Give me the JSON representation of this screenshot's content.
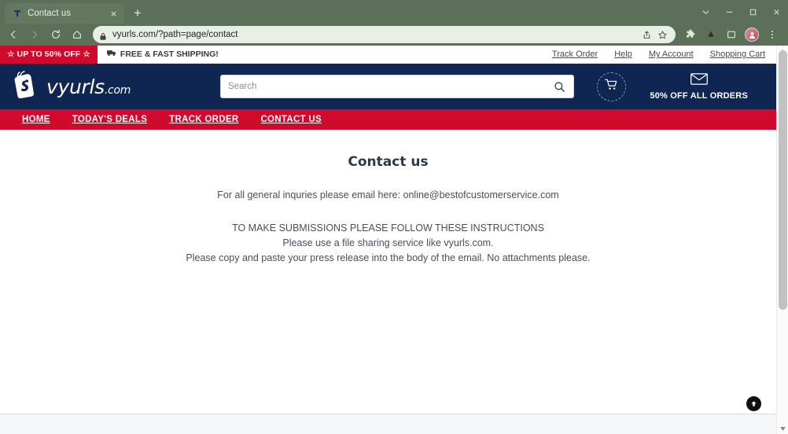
{
  "browser": {
    "tab": {
      "title": "Contact us",
      "favicon": "shopify-t-icon",
      "close_label": "×"
    },
    "new_tab_label": "+",
    "window_controls": [
      {
        "name": "tab-search",
        "glyph": "⌄"
      },
      {
        "name": "minimize",
        "glyph": "–"
      },
      {
        "name": "maximize",
        "glyph": "□"
      },
      {
        "name": "close",
        "glyph": "×"
      }
    ],
    "nav": {
      "back": "←",
      "forward": "→",
      "reload": "↻",
      "home": "⌂"
    },
    "omnibox": {
      "url": "vyurls.com/?path=page/contact",
      "lock": "lock-icon",
      "share": "share-icon",
      "bookmark": "star-icon"
    },
    "toolbar_icons": [
      {
        "name": "extensions-icon"
      },
      {
        "name": "downloads-icon"
      },
      {
        "name": "sidepanel-icon"
      },
      {
        "name": "profile-avatar"
      },
      {
        "name": "chrome-menu-icon"
      }
    ]
  },
  "utility_bar": {
    "promo_badge": "☆ UP TO 50% OFF ☆",
    "shipping_note": "FREE & FAST SHIPPING!",
    "links": [
      "Track Order",
      "Help",
      "My Account",
      "Shopping Cart"
    ]
  },
  "header": {
    "logo_name": "vyurls",
    "logo_suffix": ".com",
    "search_placeholder": "Search",
    "search_value": "",
    "cart_icon": "shopping-cart-icon",
    "promo_icon": "envelope-icon",
    "promo_text": "50% OFF ALL ORDERS"
  },
  "nav": {
    "items": [
      "HOME",
      "TODAY'S DEALS",
      "TRACK ORDER",
      "CONTACT US"
    ]
  },
  "content": {
    "title": "Contact us",
    "lead": "For all general inquries please email here: online@bestofcustomerservice.com",
    "instructions": [
      "TO MAKE SUBMISSIONS PLEASE FOLLOW THESE INSTRUCTIONS",
      "Please use a file sharing service like vyurls.com.",
      "Please copy and paste your press release into the body of the email. No attachments please."
    ]
  },
  "footer": {
    "left_text": "",
    "center_text": "",
    "right_text": ""
  },
  "scroll_top": {
    "label": "scroll-to-top"
  },
  "colors": {
    "header_navy": "#0f2552",
    "nav_red": "#cf0a2c",
    "chrome_green": "#5c6f59",
    "text_body": "#44505c"
  }
}
